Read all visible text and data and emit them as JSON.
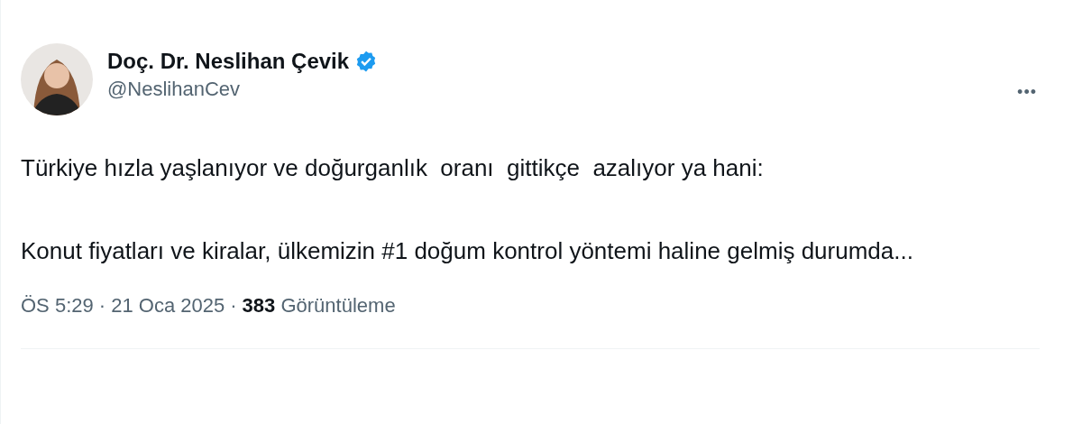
{
  "author": {
    "name": "Doç. Dr. Neslihan Çevik",
    "verified": true,
    "handle": "@NeslihanCev"
  },
  "more_button": "•••",
  "paragraphs": [
    "Türkiye hızla yaşlanıyor ve doğurganlık  oranı  gittikçe  azalıyor ya hani:",
    "Konut fiyatları ve kiralar, ülkemizin #1 doğum kontrol yöntemi haline gelmiş durumda..."
  ],
  "meta": {
    "timestamp": "ÖS 5:29 · 21 Oca 2025",
    "separator": "·",
    "views_count": "383",
    "views_label": "Görüntüleme"
  }
}
